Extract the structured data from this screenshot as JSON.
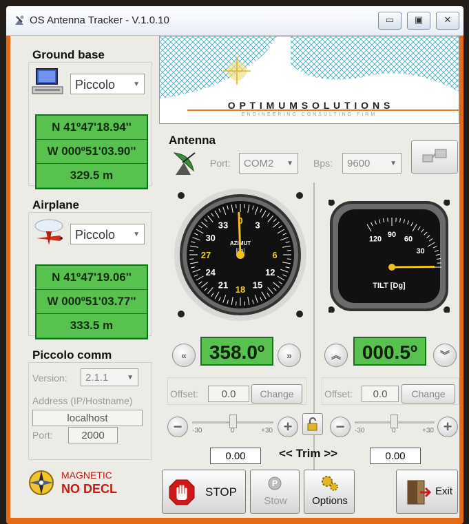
{
  "window": {
    "title": "OS Antenna Tracker - V.1.0.10",
    "controls": {
      "minimize": "▭",
      "maximize": "▣",
      "close": "✕"
    }
  },
  "ground_base": {
    "title": "Ground base",
    "source": "Piccolo",
    "lat": "N 41º47'18.94''",
    "lon": "W 000º51'03.90''",
    "alt": "329.5 m"
  },
  "airplane": {
    "title": "Airplane",
    "source": "Piccolo",
    "lat": "N 41º47'19.06''",
    "lon": "W 000º51'03.77''",
    "alt": "333.5 m"
  },
  "piccolo_comm": {
    "title": "Piccolo comm",
    "version_label": "Version:",
    "version": "2.1.1",
    "address_label": "Address (IP/Hostname)",
    "address": "localhost",
    "port_label": "Port:",
    "port": "2000"
  },
  "logo": {
    "line1": "O P T I M U M   S O L U T I O N S",
    "line2": "ENGINEERING CONSULTING FIRM"
  },
  "antenna": {
    "title": "Antenna",
    "port_label": "Port:",
    "port": "COM2",
    "bps_label": "Bps:",
    "bps": "9600"
  },
  "azimuth": {
    "gauge_label": "AZIMUT",
    "gauge_unit": "[Dg]",
    "value_deg": 358.0,
    "readout": "358.0º",
    "offset_label": "Offset:",
    "offset": "0.0",
    "change_label": "Change",
    "trim": "0.00",
    "scale": [
      "33",
      "0",
      "3",
      "6",
      "12",
      "15",
      "18",
      "21",
      "24",
      "27",
      "30"
    ]
  },
  "tilt": {
    "gauge_label": "TILT [Dg]",
    "value_deg": 0.5,
    "readout": "000.5º",
    "offset_label": "Offset:",
    "offset": "0.0",
    "change_label": "Change",
    "trim": "0.00",
    "scale": [
      "120",
      "90",
      "60",
      "30"
    ]
  },
  "trim_scale": {
    "min": "-30",
    "mid": "0",
    "max": "+30"
  },
  "trim_label": "<< Trim >>",
  "magnetic": {
    "line1": "MAGNETIC",
    "line2": "NO DECL"
  },
  "buttons": {
    "stop": "STOP",
    "stow": "Stow",
    "options": "Options",
    "exit": "Exit"
  },
  "colors": {
    "accent": "#e46a14",
    "readout": "#57c34e",
    "stop": "#d01818"
  }
}
